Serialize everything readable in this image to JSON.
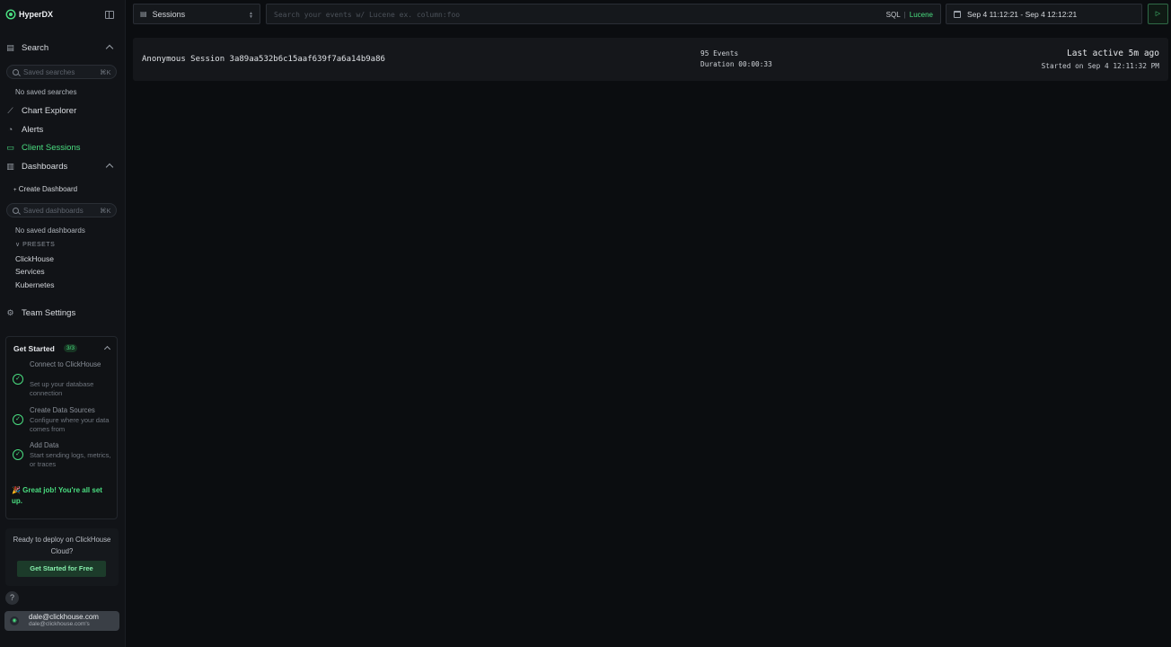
{
  "brand": {
    "name": "HyperDX"
  },
  "sidebar": {
    "search_label": "Search",
    "saved_search_placeholder": "Saved searches",
    "saved_search_kbd": "⌘K",
    "no_saved_searches": "No saved searches",
    "nav": [
      {
        "label": "Chart Explorer",
        "icon": "chart-icon"
      },
      {
        "label": "Alerts",
        "icon": "bell-icon"
      },
      {
        "label": "Client Sessions",
        "icon": "laptop-icon",
        "active": true
      }
    ],
    "dashboards_label": "Dashboards",
    "create_dashboard": "Create Dashboard",
    "dashboard_search_placeholder": "Saved dashboards",
    "dashboard_search_kbd": "⌘K",
    "no_saved_dashboards": "No saved dashboards",
    "presets_label": "PRESETS",
    "presets": [
      "ClickHouse",
      "Services",
      "Kubernetes"
    ],
    "team_settings": "Team Settings"
  },
  "get_started": {
    "title": "Get Started",
    "badge": "3/3",
    "steps": [
      {
        "title": "Connect to ClickHouse",
        "desc": "Set up your database connection"
      },
      {
        "title": "Create Data Sources",
        "desc": "Configure where your data comes from"
      },
      {
        "title": "Add Data",
        "desc": "Start sending logs, metrics, or traces"
      }
    ],
    "done_message": "🎉 Great job! You're all set up."
  },
  "deploy": {
    "text": "Ready to deploy on ClickHouse Cloud?",
    "button": "Get Started for Free"
  },
  "help": "?",
  "user": {
    "email": "dale@clickhouse.com",
    "sub": "dale@clickhouse.com's"
  },
  "topbar": {
    "source": "Sessions",
    "query_placeholder": "Search your events w/ Lucene ex. column:foo",
    "lang_sql": "SQL",
    "lang_sep": "|",
    "lang_lucene": "Lucene",
    "time_range": "Sep 4 11:12:21 - Sep 4 12:12:21",
    "run": "▷"
  },
  "session": {
    "title": "Anonymous Session 3a89aa532b6c15aaf639f7a6a14b9a86",
    "events": "95 Events",
    "duration": "Duration 00:00:33",
    "last_active": "Last active 5m ago",
    "started": "Started on Sep 4 12:11:32 PM"
  },
  "colors": {
    "accent": "#4ade80",
    "background": "#0b0d10",
    "sidebar": "#111317"
  }
}
